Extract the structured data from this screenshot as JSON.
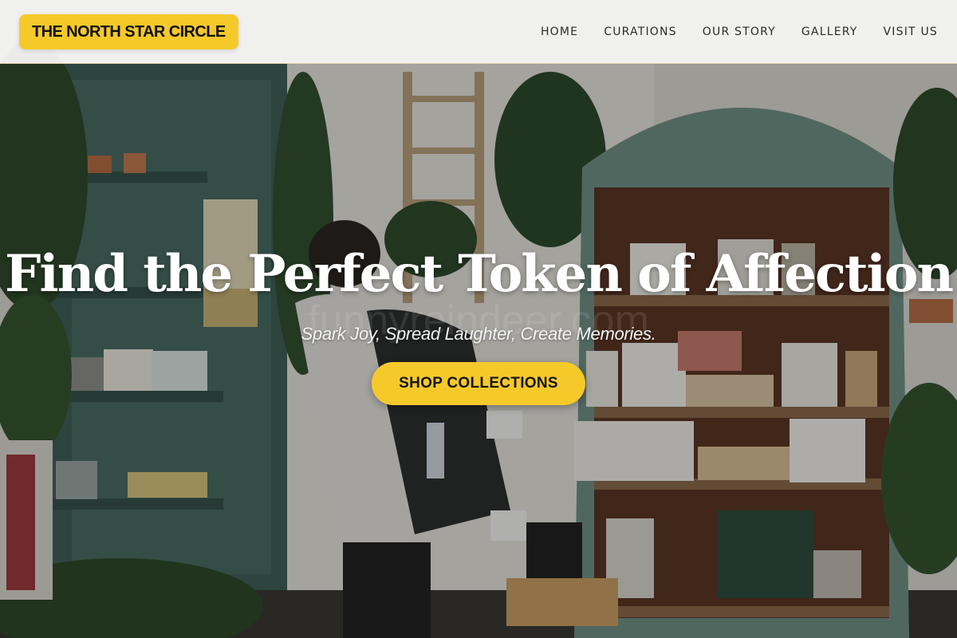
{
  "header": {
    "brand": "THE NORTH STAR CIRCLE",
    "nav": [
      {
        "label": "HOME"
      },
      {
        "label": "CURATIONS"
      },
      {
        "label": "OUR STORY"
      },
      {
        "label": "GALLERY"
      },
      {
        "label": "VISIT US"
      }
    ]
  },
  "hero": {
    "headline": "Find the Perfect Token of Affection",
    "tagline": "Spark Joy, Spread Laughter, Create Memories.",
    "cta_label": "SHOP COLLECTIONS",
    "watermark": "funnyreindeer.com"
  },
  "colors": {
    "accent": "#f6c92b",
    "header_bg": "#f4f4f3",
    "cabinet": "#6f8f86"
  }
}
